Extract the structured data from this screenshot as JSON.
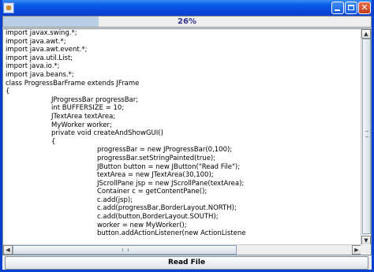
{
  "window": {
    "title": "",
    "controls": {
      "minimize": "minimize-icon",
      "maximize": "maximize-icon",
      "close": "close-icon"
    }
  },
  "progress": {
    "value": 0.26,
    "label": "26%",
    "fill_color": "#b8cfe5",
    "text_color": "#333399"
  },
  "code_lines": [
    "import javax.swing.*;",
    "import java.awt.*;",
    "import java.awt.event.*;",
    "import java.util.List;",
    "import java.io.*;",
    "import java.beans.*;",
    "class ProgressBarFrame extends JFrame",
    "{",
    "\t\tJProgressBar progressBar;",
    "\t\tint BUFFERSIZE = 10;",
    "\t\tJTextArea textArea;",
    "\t\tMyWorker worker;",
    "\t\tprivate void createAndShowGUI()",
    "\t\t{",
    "\t\t\t\tprogressBar = new JProgressBar(0,100);",
    "\t\t\t\tprogressBar.setStringPainted(true);",
    "\t\t\t\tJButton button = new JButton(\"Read File\");",
    "\t\t\t\ttextArea = new JTextArea(30,100);",
    "\t\t\t\tJScrollPane jsp = new JScrollPane(textArea);",
    "\t\t\t\tContainer c = getContentPane();",
    "\t\t\t\tc.add(jsp);",
    "\t\t\t\tc.add(progressBar,BorderLayout.NORTH);",
    "\t\t\t\tc.add(button,BorderLayout.SOUTH);",
    "\t\t\t\tworker = new MyWorker();",
    "\t\t\t\tbutton.addActionListener(new ActionListene"
  ],
  "read_button": {
    "label": "Read File"
  },
  "scroll": {
    "up_arrow": "▲",
    "down_arrow": "▼",
    "left_arrow": "◀",
    "right_arrow": "▶"
  }
}
